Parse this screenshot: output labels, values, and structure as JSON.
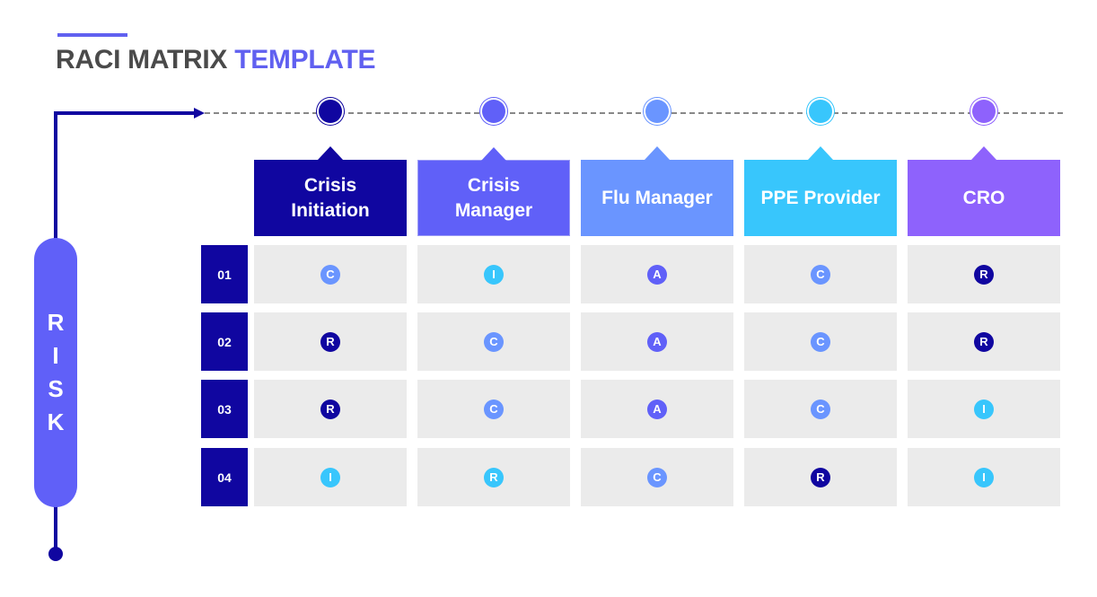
{
  "title": {
    "main": "RACI MATRIX",
    "highlight": "TEMPLATE"
  },
  "side_label": [
    "R",
    "I",
    "S",
    "K"
  ],
  "colors": {
    "navy": "#1006a0",
    "indigo": "#6060f8",
    "periwinkle": "#6a95ff",
    "cyan": "#38c6fc",
    "violet": "#8e62fc",
    "title_gray": "#4a4a4a",
    "cell_bg": "#ebebeb"
  },
  "columns": [
    {
      "label": "Crisis Initiation",
      "color": "#1006a0"
    },
    {
      "label": "Crisis Manager",
      "color": "#6060f8"
    },
    {
      "label": "Flu Manager",
      "color": "#6a95ff"
    },
    {
      "label": "PPE Provider",
      "color": "#38c6fc"
    },
    {
      "label": "CRO",
      "color": "#8e62fc"
    }
  ],
  "rows": [
    {
      "num": "01",
      "cells": [
        {
          "letter": "C",
          "color": "#6a95ff"
        },
        {
          "letter": "I",
          "color": "#38c6fc"
        },
        {
          "letter": "A",
          "color": "#6060f8"
        },
        {
          "letter": "C",
          "color": "#6a95ff"
        },
        {
          "letter": "R",
          "color": "#1006a0"
        }
      ]
    },
    {
      "num": "02",
      "cells": [
        {
          "letter": "R",
          "color": "#1006a0"
        },
        {
          "letter": "C",
          "color": "#6a95ff"
        },
        {
          "letter": "A",
          "color": "#6060f8"
        },
        {
          "letter": "C",
          "color": "#6a95ff"
        },
        {
          "letter": "R",
          "color": "#1006a0"
        }
      ]
    },
    {
      "num": "03",
      "cells": [
        {
          "letter": "R",
          "color": "#1006a0"
        },
        {
          "letter": "C",
          "color": "#6a95ff"
        },
        {
          "letter": "A",
          "color": "#6060f8"
        },
        {
          "letter": "C",
          "color": "#6a95ff"
        },
        {
          "letter": "I",
          "color": "#38c6fc"
        }
      ]
    },
    {
      "num": "04",
      "cells": [
        {
          "letter": "I",
          "color": "#38c6fc"
        },
        {
          "letter": "R",
          "color": "#38c6fc"
        },
        {
          "letter": "C",
          "color": "#6a95ff"
        },
        {
          "letter": "R",
          "color": "#1006a0"
        },
        {
          "letter": "I",
          "color": "#38c6fc"
        }
      ]
    }
  ]
}
